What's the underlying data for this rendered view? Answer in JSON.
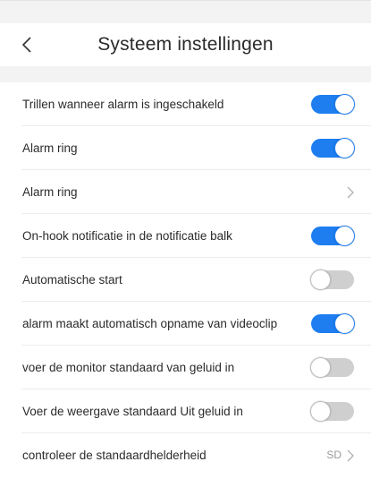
{
  "header": {
    "title": "Systeem instellingen",
    "back_icon": "chevron-left-icon"
  },
  "settings": [
    {
      "label": "Trillen wanneer alarm is ingeschakeld",
      "type": "toggle",
      "state": "on"
    },
    {
      "label": "Alarm ring",
      "type": "toggle",
      "state": "on"
    },
    {
      "label": "Alarm ring",
      "type": "link"
    },
    {
      "label": "On-hook notificatie in de notificatie balk",
      "type": "toggle",
      "state": "on"
    },
    {
      "label": "Automatische start",
      "type": "toggle",
      "state": "off"
    },
    {
      "label": "alarm maakt automatisch opname van videoclip",
      "type": "toggle",
      "state": "on"
    },
    {
      "label": "voer de monitor standaard van geluid in",
      "type": "toggle",
      "state": "off"
    },
    {
      "label": "Voer de weergave standaard Uit geluid in",
      "type": "toggle",
      "state": "off"
    },
    {
      "label": "controleer de standaardhelderheid",
      "type": "link",
      "value": "SD"
    }
  ],
  "colors": {
    "toggle_on": "#1e7ef0",
    "toggle_off": "#cfcfcf",
    "background_strip": "#f3f3f3"
  }
}
